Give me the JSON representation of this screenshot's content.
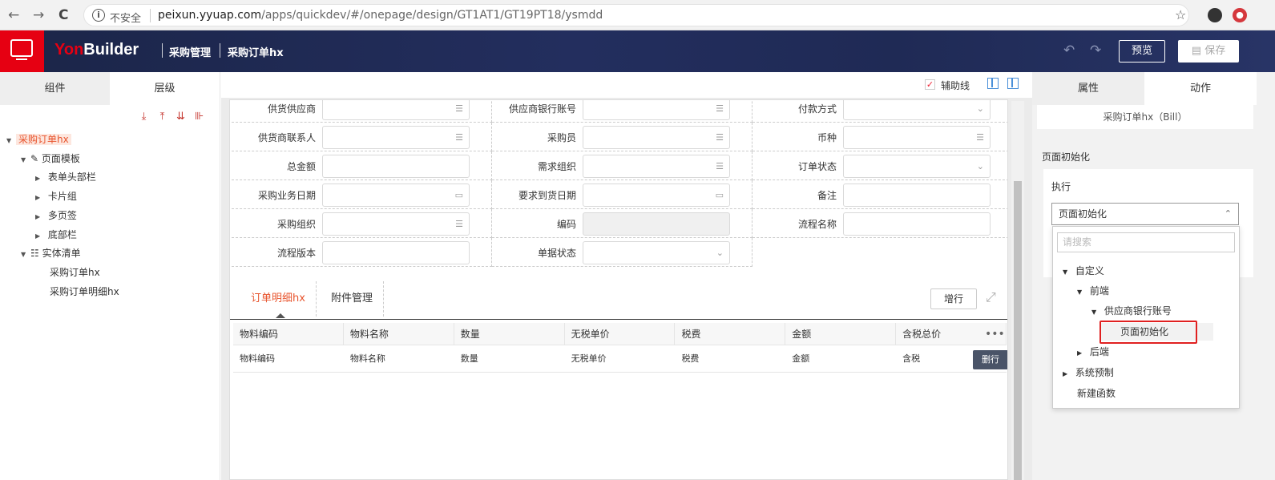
{
  "browser": {
    "back": "←",
    "forward": "→",
    "reload": "C",
    "info": "i",
    "unsafe_label": "不安全",
    "url_host": "peixun.yyuap.com",
    "url_path": "/apps/quickdev/#/onepage/design/GT1AT1/GT19PT18/ysmdd",
    "star": "☆"
  },
  "header": {
    "brand_yon": "Yon",
    "brand_builder": "Builder",
    "crumb1": "采购管理",
    "crumb2": "采购订单hx",
    "undo": "↶",
    "redo": "↷",
    "preview": "预览",
    "save": "保存"
  },
  "left": {
    "tab_components": "组件",
    "tab_layers": "层级",
    "tools": [
      "⤓",
      "⤒",
      "⇊",
      "⊪"
    ],
    "tree": {
      "root": "采购订单hx",
      "page_template": "页面模板",
      "form_header": "表单头部栏",
      "card_group": "卡片组",
      "multi_tab": "多页签",
      "footer": "底部栏",
      "entity_list": "实体清单",
      "entity1": "采购订单hx",
      "entity2": "采购订单明细hx"
    }
  },
  "canvas": {
    "helper_lines": "辅助线",
    "check_mark": "✓",
    "fields": [
      {
        "label": "供货供应商",
        "icon": "☰"
      },
      {
        "label": "供应商银行账号",
        "icon": "☰"
      },
      {
        "label": "付款方式",
        "icon": "⌄"
      },
      {
        "label": "供货商联系人",
        "icon": "☰"
      },
      {
        "label": "采购员",
        "icon": "☰"
      },
      {
        "label": "币种",
        "icon": "☰"
      },
      {
        "label": "总金额",
        "icon": ""
      },
      {
        "label": "需求组织",
        "icon": "☰"
      },
      {
        "label": "订单状态",
        "icon": "⌄"
      },
      {
        "label": "采购业务日期",
        "icon": "▭"
      },
      {
        "label": "要求到货日期",
        "icon": "▭"
      },
      {
        "label": "备注",
        "icon": ""
      },
      {
        "label": "采购组织",
        "icon": "☰"
      },
      {
        "label": "编码",
        "icon": ""
      },
      {
        "label": "流程名称",
        "icon": ""
      },
      {
        "label": "流程版本",
        "icon": ""
      },
      {
        "label": "单据状态",
        "icon": "⌄"
      }
    ],
    "tab_detail": "订单明细hx",
    "tab_attach": "附件管理",
    "add_row": "增行",
    "fullscreen": "⤢",
    "table_headers": [
      "物料编码",
      "物料名称",
      "数量",
      "无税单价",
      "税费",
      "金额",
      "含税总价"
    ],
    "table_row": [
      "物料编码",
      "物料名称",
      "数量",
      "无税单价",
      "税费",
      "金额",
      "含税"
    ],
    "more": "•••",
    "delete_row": "删行"
  },
  "right": {
    "tab_props": "属性",
    "tab_actions": "动作",
    "bill_name": "采购订单hx（Bill）",
    "section_title": "页面初始化",
    "exec_label": "执行",
    "select_value": "页面初始化",
    "select_chev": "⌃",
    "search_placeholder": "请搜索",
    "dd": {
      "custom": "自定义",
      "frontend": "前端",
      "bank_account": "供应商银行账号",
      "page_init": "页面初始化",
      "backend": "后端",
      "system_preset": "系统预制",
      "new_function": "新建函数"
    }
  }
}
